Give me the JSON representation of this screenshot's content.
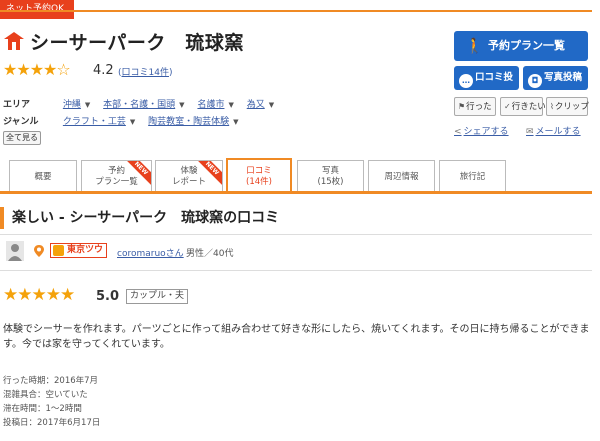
{
  "header": {
    "net_badge": "ネット予約OK",
    "spot_title": "シーサーパーク　琉球窯",
    "rating_stars": "★★★★☆",
    "rating_value": "4.2",
    "review_count_open": "(",
    "review_count_link": "口コミ14件",
    "review_count_close": ")"
  },
  "info": {
    "area_label": "エリア",
    "area_items": [
      "沖縄",
      "本部・名護・国頭",
      "名護市",
      "為又"
    ],
    "genre_label": "ジャンル",
    "genre_items": [
      "クラフト・工芸",
      "陶芸教室・陶芸体験"
    ],
    "show_all": "全て見る"
  },
  "actions": {
    "plan_button": "予約プラン一覧",
    "review_post": "口コミ投稿",
    "photo_post": "写真投稿",
    "went": "行った",
    "want": "行きたい",
    "clip": "クリップ",
    "share": "シェアする",
    "mail": "メールする"
  },
  "tabs": [
    {
      "line1": "概要",
      "line2": ""
    },
    {
      "line1": "予約",
      "line2": "プラン一覧",
      "tag": "NEW"
    },
    {
      "line1": "体験",
      "line2": "レポート",
      "tag": "NEW"
    },
    {
      "line1": "口コミ",
      "line2": "(14件)"
    },
    {
      "line1": "写真",
      "line2": "(15枚)"
    },
    {
      "line1": "周辺情報",
      "line2": ""
    },
    {
      "line1": "旅行記",
      "line2": ""
    }
  ],
  "review": {
    "section_title": "楽しい - シーサーパーク　琉球窯の口コミ",
    "region": "東京ツウ",
    "user_name": "coromaruoさん",
    "user_meta": "男性／40代",
    "stars": "★★★★★",
    "score": "5.0",
    "companion": "カップル・夫",
    "body": "体験でシーサーを作れます。パーツごとに作って組み合わせて好きな形にしたら、焼いてくれます。その日に持ち帰ることができます。今では家を守ってくれています。",
    "meta": [
      "行った時期：2016年7月",
      "混雑具合：空いていた",
      "滞在時間：1～2時間",
      "投稿日：2017年6月17日"
    ]
  },
  "colors": {
    "accent_orange": "#f08a24",
    "badge_red": "#e8401c",
    "button_blue": "#2169c6",
    "star_gold": "#f4a20b",
    "link_blue": "#3a5da6"
  },
  "icons": {
    "spot": "pagoda-icon",
    "plan": "person-walking-icon",
    "review_post": "speech-bubble-icon",
    "photo_post": "camera-icon",
    "went": "flag-icon",
    "want": "check-icon",
    "clip": "paperclip-icon",
    "share": "share-icon",
    "mail": "mail-icon",
    "avatar": "user-avatar-icon",
    "region": "map-pin-icon"
  }
}
